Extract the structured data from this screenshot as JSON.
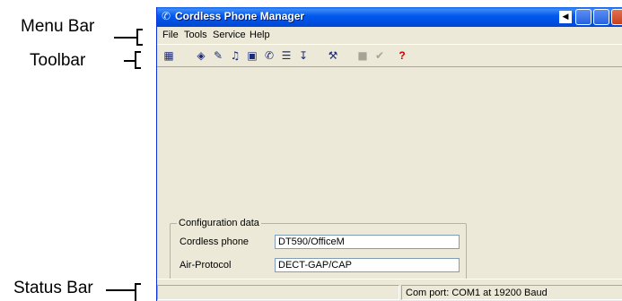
{
  "callouts": {
    "menu_bar": "Menu Bar",
    "toolbar": "Toolbar",
    "status_bar": "Status Bar"
  },
  "window": {
    "title": "Cordless Phone Manager",
    "app_icon": "phone-app-icon"
  },
  "menubar": {
    "items": [
      {
        "label": "File"
      },
      {
        "label": "Tools"
      },
      {
        "label": "Service"
      },
      {
        "label": "Help"
      }
    ]
  },
  "toolbar": {
    "icons": [
      "phonebook-icon",
      "eraser-icon",
      "edit-icon",
      "music-note-icon",
      "form-icon",
      "phone-icon",
      "list-icon",
      "download-icon",
      "wrench-icon",
      "delete-icon",
      "checkmark-icon",
      "help-icon"
    ]
  },
  "config": {
    "group_title": "Configuration data",
    "cordless_phone_label": "Cordless phone",
    "cordless_phone_value": "DT590/OfficeM",
    "air_protocol_label": "Air-Protocol",
    "air_protocol_value": "DECT-GAP/CAP"
  },
  "statusbar": {
    "com_port": "Com port: COM1 at 19200 Baud"
  },
  "colors": {
    "titlebar": "#0058ee",
    "window_bg": "#ece9d8",
    "close_button": "#c8401c"
  }
}
